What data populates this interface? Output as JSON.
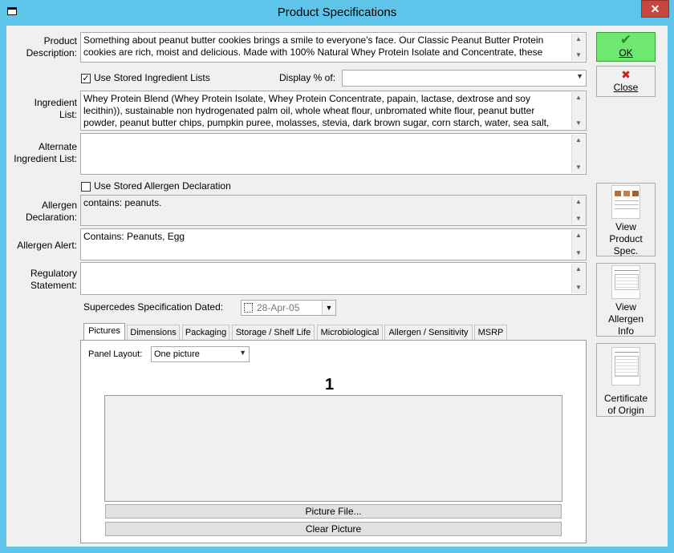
{
  "window": {
    "title": "Product Specifications",
    "close_glyph": "✕"
  },
  "labels": {
    "product_description": [
      "Product",
      "Description:"
    ],
    "ingredient_list": [
      "Ingredient",
      "List:"
    ],
    "alternate_ingredient": [
      "Alternate",
      "Ingredient List:"
    ],
    "allergen_declaration": [
      "Allergen",
      "Declaration:"
    ],
    "allergen_alert": "Allergen Alert:",
    "regulatory": [
      "Regulatory",
      "Statement:"
    ]
  },
  "fields": {
    "product_description": "Something about peanut butter cookies brings a smile to everyone's face. Our Classic Peanut Butter Protein cookies are rich, moist and delicious. Made with 100% Natural Whey Protein Isolate and Concentrate, these",
    "ingredient_list": "Whey Protein Blend (Whey Protein Isolate, Whey Protein Concentrate, papain, lactase, dextrose and soy lecithin)), sustainable non hydrogenated palm oil, whole wheat flour, unbromated white flour, peanut butter powder, peanut butter chips, pumpkin puree, molasses, stevia, dark brown sugar, corn starch, water, sea salt,",
    "alternate_ingredient": "",
    "allergen_declaration": "contains: peanuts.",
    "allergen_alert": "Contains: Peanuts, Egg",
    "regulatory": ""
  },
  "checks": {
    "use_stored_ingredient": {
      "label": "Use Stored Ingredient Lists",
      "checked": true,
      "glyph": "✓"
    },
    "use_stored_allergen": {
      "label": "Use Stored Allergen Declaration",
      "checked": false,
      "glyph": ""
    }
  },
  "display_pct": {
    "label": "Display % of:",
    "value": ""
  },
  "supercedes": {
    "label": "Supercedes Specification Dated:",
    "value": "28-Apr-05"
  },
  "tabs": [
    {
      "label": "Pictures",
      "active": true
    },
    {
      "label": "Dimensions"
    },
    {
      "label": "Packaging"
    },
    {
      "label": "Storage / Shelf Life"
    },
    {
      "label": "Microbiological"
    },
    {
      "label": "Allergen / Sensitivity"
    },
    {
      "label": "MSRP"
    }
  ],
  "pictures": {
    "panel_layout_label": "Panel Layout:",
    "panel_layout_value": "One picture",
    "picture_number": "1",
    "picture_file_button": "Picture File...",
    "clear_picture_button": "Clear Picture"
  },
  "buttons": {
    "ok": {
      "label": "OK",
      "icon": "checkmark-icon",
      "glyph": "✔",
      "color": "#2e8b22",
      "bg": "#6fe86f"
    },
    "close": {
      "label": "Close",
      "icon": "x-icon",
      "glyph": "✖",
      "color": "#cc1f1f"
    }
  },
  "side_buttons": [
    {
      "lines": [
        "View",
        "Product",
        "Spec."
      ]
    },
    {
      "lines": [
        "View",
        "Allergen",
        "Info"
      ]
    },
    {
      "lines": [
        "Certificate",
        "of Origin"
      ]
    }
  ],
  "scroll_glyphs": {
    "up": "▲",
    "down": "▼",
    "combo": "▼"
  }
}
